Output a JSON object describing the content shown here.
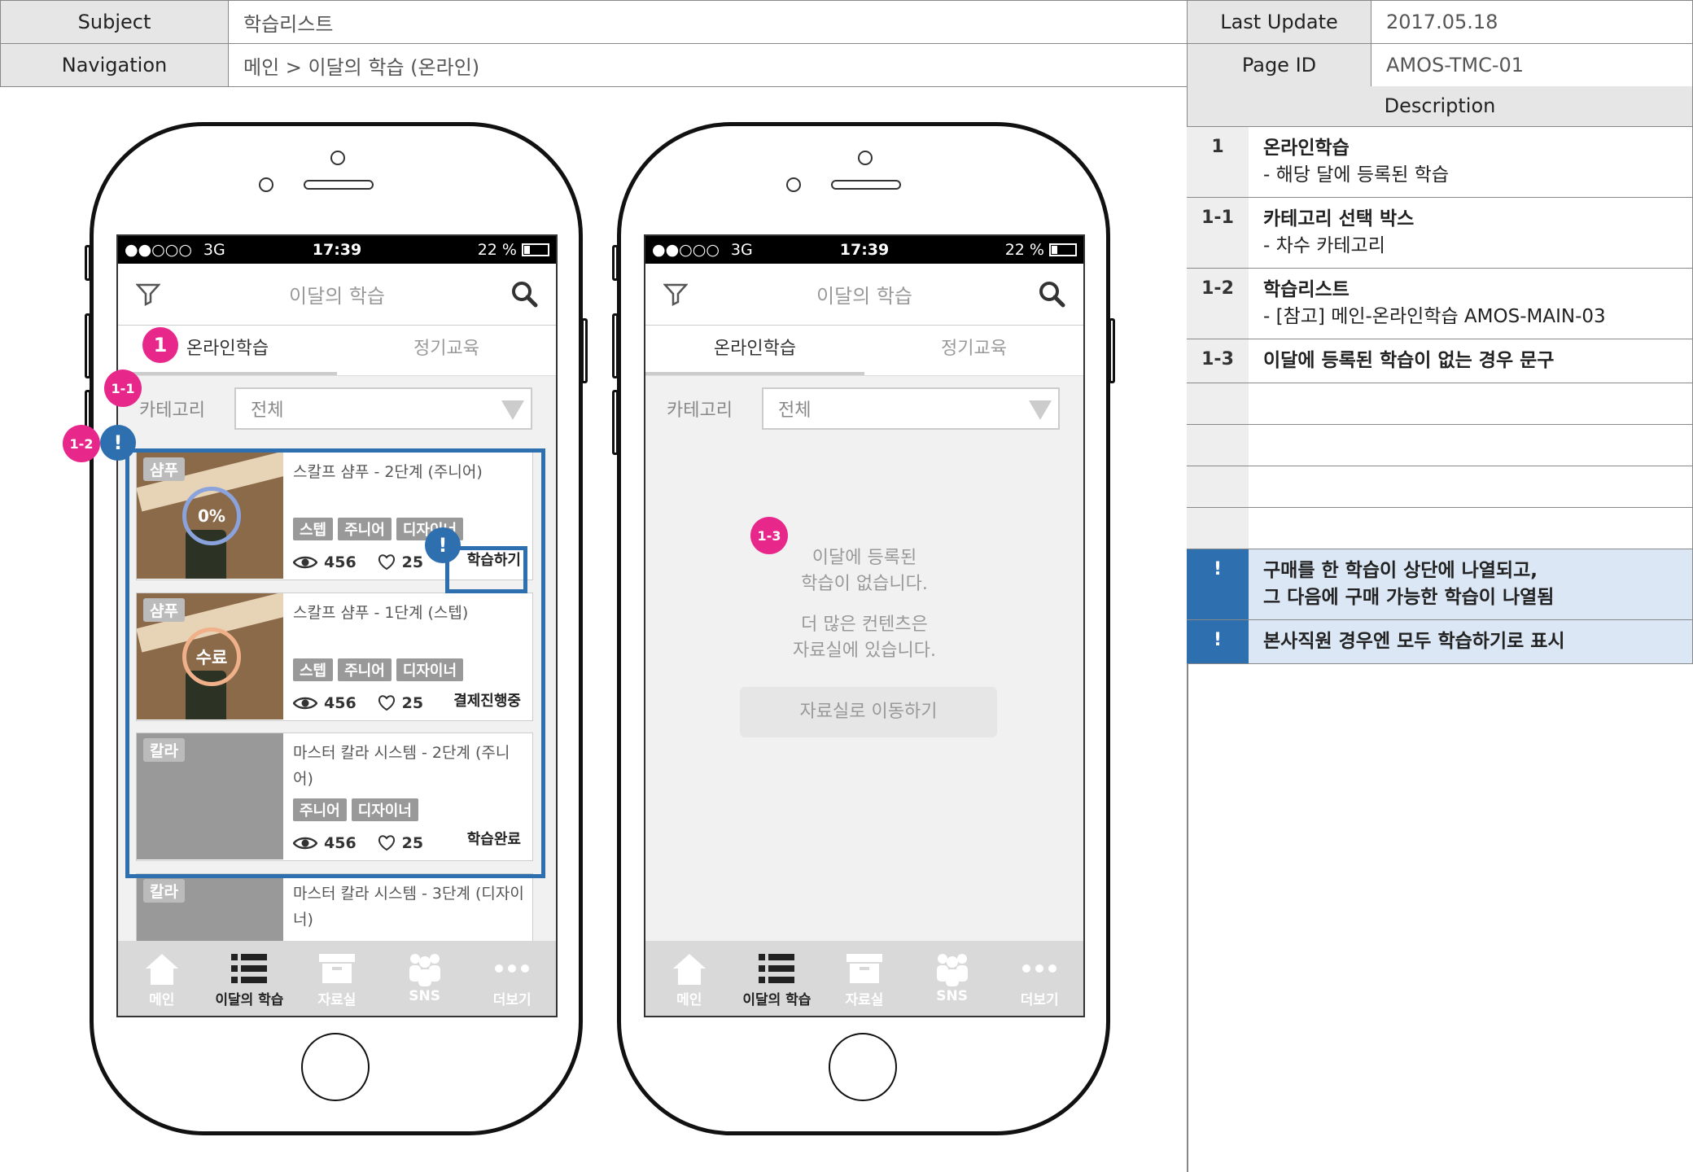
{
  "header": {
    "subject_label": "Subject",
    "subject_value": "학습리스트",
    "last_update_label": "Last Update",
    "last_update_value": "2017.05.18",
    "navigation_label": "Navigation",
    "navigation_value": "메인 > 이달의 학습 (온라인)",
    "page_id_label": "Page ID",
    "page_id_value": "AMOS-TMC-01"
  },
  "phone": {
    "status": {
      "signal": "●●○○○",
      "network": "3G",
      "time": "17:39",
      "battery": "22 %"
    },
    "title": "이달의 학습",
    "tabs": [
      "온라인학습",
      "정기교육"
    ],
    "category_label": "카테고리",
    "category_value": "전체",
    "nav": [
      "메인",
      "이달의 학습",
      "자료실",
      "SNS",
      "더보기"
    ]
  },
  "cards": [
    {
      "badge": "샴푸",
      "title": "스칼프 샴푸 - 2단계 (주니어)",
      "tags": [
        "스텝",
        "주니어",
        "디자이너"
      ],
      "progress": "0%",
      "views": "456",
      "likes": "25",
      "action": "학습하기"
    },
    {
      "badge": "샴푸",
      "title": "스칼프 샴푸 - 1단계 (스텝)",
      "tags": [
        "스텝",
        "주니어",
        "디자이너"
      ],
      "progress": "수료",
      "views": "456",
      "likes": "25",
      "action": "결제진행중"
    },
    {
      "badge": "칼라",
      "title": "마스터 칼라 시스템 - 2단계 (주니어)",
      "tags": [
        "주니어",
        "디자이너"
      ],
      "views": "456",
      "likes": "25",
      "action": "학습완료"
    },
    {
      "badge": "칼라",
      "title": "마스터 칼라 시스템 - 3단계 (디자이너)"
    }
  ],
  "empty": {
    "line1": "이달에 등록된",
    "line2": "학습이 없습니다.",
    "line3": "더 많은 컨텐츠은",
    "line4": "자료실에 있습니다.",
    "button": "자료실로 이동하기"
  },
  "markers": {
    "m1": "1",
    "m11": "1-1",
    "m12": "1-2",
    "m13": "1-3",
    "excl": "!"
  },
  "description": {
    "heading": "Description",
    "rows": [
      {
        "num": "1",
        "title": "온라인학습",
        "sub": "-    해당 달에 등록된 학습"
      },
      {
        "num": "1-1",
        "title": "카테고리 선택 박스",
        "sub": "-    차수 카테고리"
      },
      {
        "num": "1-2",
        "title": "학습리스트",
        "sub": "- [참고] 메인-온라인학습 AMOS-MAIN-03"
      },
      {
        "num": "1-3",
        "title": "이달에 등록된 학습이 없는 경우 문구",
        "sub": ""
      }
    ],
    "notes": [
      {
        "num": "!",
        "text": "구매를 한 학습이 상단에 나열되고,",
        "text2": "그 다음에 구매 가능한 학습이 나열됨"
      },
      {
        "num": "!",
        "text": "본사직원 경우엔 모두 학습하기로 표시",
        "text2": ""
      }
    ]
  }
}
